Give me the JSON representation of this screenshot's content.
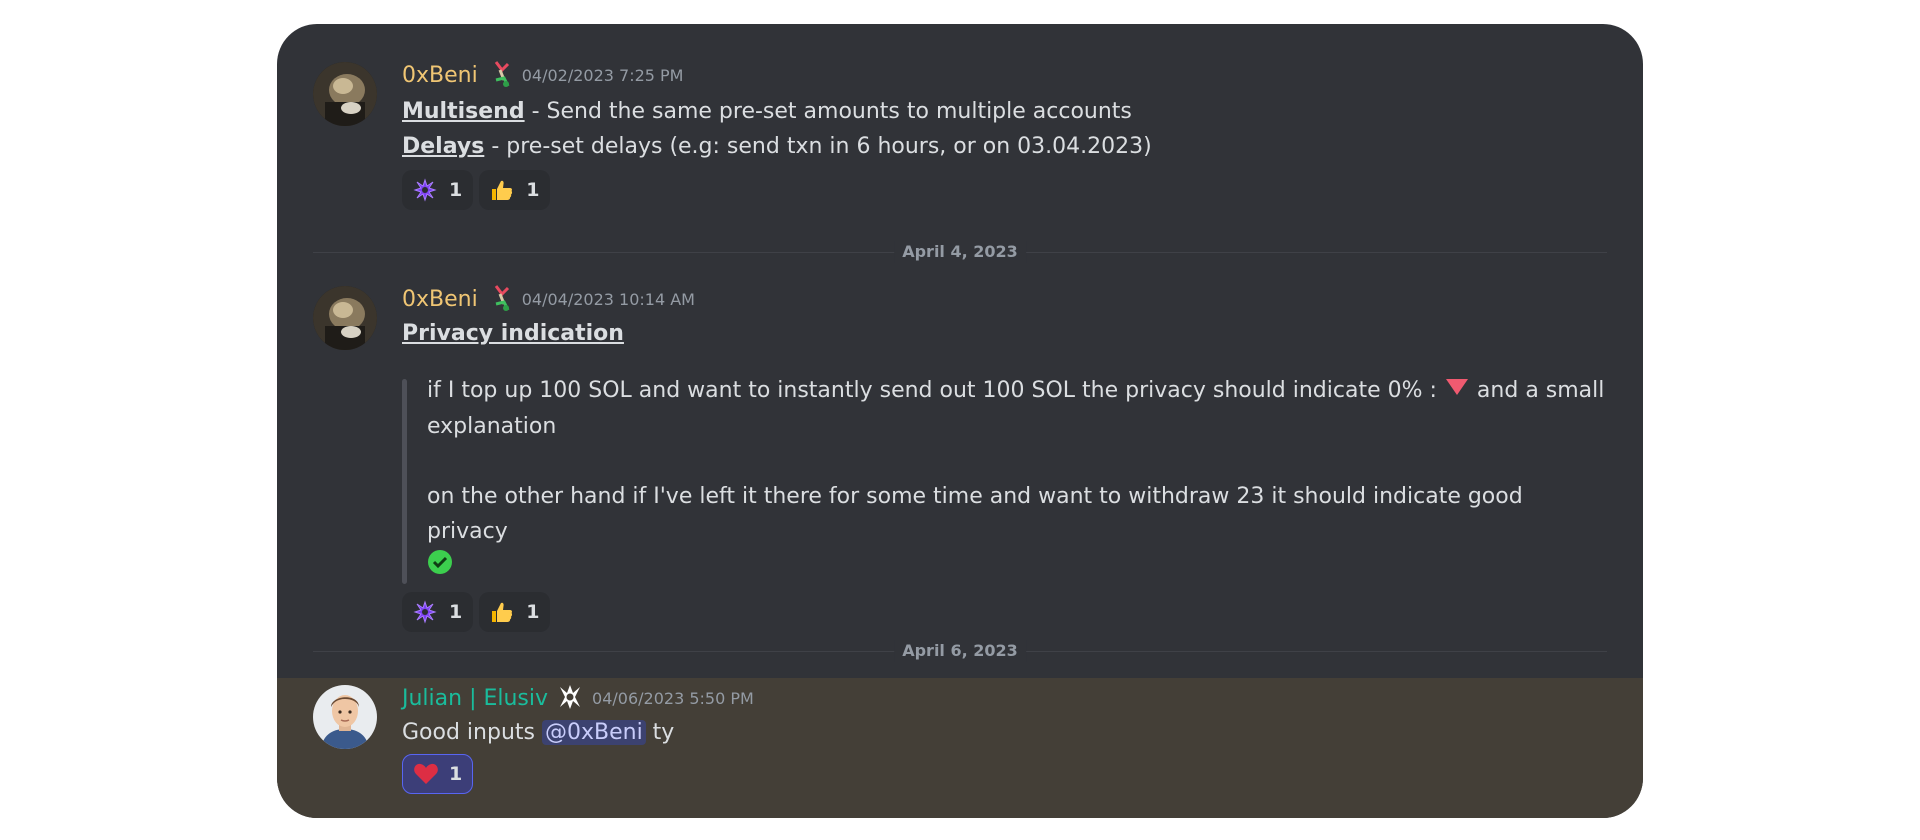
{
  "messages": [
    {
      "author": "0xBeni",
      "timestamp": "04/02/2023 7:25 PM",
      "line1_link": "Multisend",
      "line1_rest": " - Send the same pre-set amounts to multiple accounts",
      "line2_link": "Delays",
      "line2_rest": " - pre-set delays (e.g: send txn in 6 hours, or on 03.04.2023)",
      "reactions": [
        {
          "icon": "elusiv-logo-icon",
          "count": "1"
        },
        {
          "icon": "thumbs-up-icon",
          "count": "1"
        }
      ]
    },
    {
      "author": "0xBeni",
      "timestamp": "04/04/2023 10:14 AM",
      "title_link": "Privacy indication",
      "quote_p1a": "if I top up 100 SOL and want to instantly send out 100 SOL the privacy should indicate 0% :",
      "quote_p1b": " and a small",
      "quote_p1c": "explanation",
      "quote_p2": "on the other hand if I've left it there for some time and want to withdraw 23 it should indicate good privacy",
      "reactions": [
        {
          "icon": "elusiv-logo-icon",
          "count": "1"
        },
        {
          "icon": "thumbs-up-icon",
          "count": "1"
        }
      ]
    },
    {
      "author": "Julian | Elusiv",
      "timestamp": "04/06/2023 5:50 PM",
      "text_before": "Good inputs ",
      "mention": "@0xBeni",
      "text_after": " ty",
      "reactions": [
        {
          "icon": "heart-icon",
          "count": "1"
        }
      ]
    }
  ],
  "dividers": [
    "April 4, 2023",
    "April 6, 2023"
  ],
  "colors": {
    "background": "#313338",
    "author_gold": "#f0c674",
    "author_teal": "#1abc9c",
    "highlight": "#443f37",
    "mention": "#3c4270"
  }
}
